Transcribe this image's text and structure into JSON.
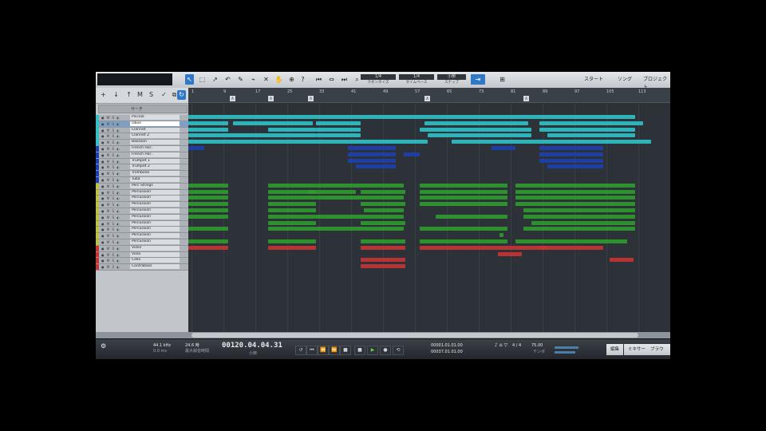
{
  "toolbar": {
    "groups": [
      {
        "label": "1/4",
        "sub": "クオンタイズ"
      },
      {
        "label": "1/4",
        "sub": "タイムベース"
      },
      {
        "label": "小節",
        "sub": "スナップ"
      }
    ],
    "right_buttons": [
      "スタート",
      "ソング",
      "プロジェクト"
    ]
  },
  "browser": {
    "search_placeholder": "サーチ"
  },
  "tracks": [
    {
      "name": "Piccolo",
      "color": "#2ec2c9"
    },
    {
      "name": "Oboe",
      "color": "#2ec2c9",
      "selected": true
    },
    {
      "name": "Clarinet",
      "color": "#2ec2c9"
    },
    {
      "name": "Clarinet 2",
      "color": "#2ec2c9"
    },
    {
      "name": "Bassoon",
      "color": "#2ec2c9"
    },
    {
      "name": "French Hor..",
      "color": "#1e3fb0"
    },
    {
      "name": "French Hor..",
      "color": "#1e3fb0"
    },
    {
      "name": "Trumpet 1",
      "color": "#1e3fb0"
    },
    {
      "name": "Trumpet 2",
      "color": "#1e3fb0"
    },
    {
      "name": "Trombone",
      "color": "#1e3fb0"
    },
    {
      "name": "Tuba",
      "color": "#1e3fb0"
    },
    {
      "name": "Perc Strings",
      "color": "#c0c23a"
    },
    {
      "name": "Percussion",
      "color": "#c0c23a"
    },
    {
      "name": "Percussion",
      "color": "#c0c23a"
    },
    {
      "name": "Percussion",
      "color": "#c0c23a"
    },
    {
      "name": "Percussion",
      "color": "#c0c23a"
    },
    {
      "name": "Percussion",
      "color": "#c0c23a"
    },
    {
      "name": "Percussion",
      "color": "#c0c23a"
    },
    {
      "name": "Percussion",
      "color": "#c0c23a"
    },
    {
      "name": "Percussion",
      "color": "#c0c23a"
    },
    {
      "name": "Percussion",
      "color": "#c0c23a"
    },
    {
      "name": "Violin",
      "color": "#c83333"
    },
    {
      "name": "Viola",
      "color": "#c83333"
    },
    {
      "name": "Cello",
      "color": "#c83333"
    },
    {
      "name": "Contrabass",
      "color": "#c83333"
    }
  ],
  "ruler": {
    "numbers": [
      "1",
      "9",
      "17",
      "25",
      "33",
      "41",
      "49",
      "57",
      "65",
      "73",
      "81",
      "89",
      "97",
      "105",
      "113"
    ]
  },
  "transport": {
    "sample_rate": "44.1 kHz",
    "sample_rate_sub": "0.0 ms",
    "record_info": "24.6 時",
    "record_info_sub": "最大録音時間",
    "time": "00120.04.04.31",
    "time_sub": "小節",
    "loop_start": "00001.01.01.00",
    "loop_end": "00037.01.01.00",
    "timesig": "4 / 4",
    "tempo": "75.00",
    "tempo_label": "テンポ",
    "right_buttons": [
      "編集",
      "ミキサー",
      "ブラウズ"
    ]
  }
}
